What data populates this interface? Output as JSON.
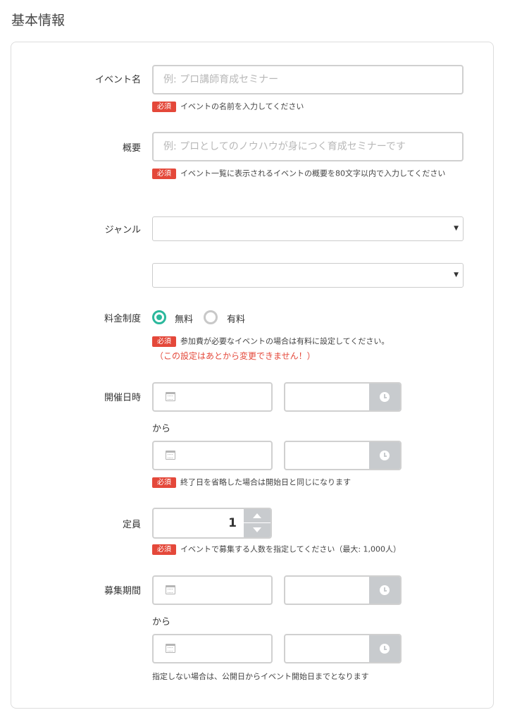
{
  "section_title": "基本情報",
  "event_name": {
    "label": "イベント名",
    "placeholder": "例: プロ講師育成セミナー",
    "required_badge": "必須",
    "help": "イベントの名前を入力してください"
  },
  "summary": {
    "label": "概要",
    "placeholder": "例: プロとしてのノウハウが身につく育成セミナーです",
    "required_badge": "必須",
    "help": "イベント一覧に表示されるイベントの概要を80文字以内で入力してください"
  },
  "genre": {
    "label": "ジャンル",
    "select1_value": "",
    "select2_value": "",
    "caret": "▼"
  },
  "fee": {
    "label": "料金制度",
    "options": [
      "無料",
      "有料"
    ],
    "selected": "無料",
    "required_badge": "必須",
    "help": "参加費が必要なイベントの場合は有料に設定してください。",
    "warning": "（この設定はあとから変更できません！）"
  },
  "event_datetime": {
    "label": "開催日時",
    "from_text": "から",
    "required_badge": "必須",
    "help": "終了日を省略した場合は開始日と同じになります"
  },
  "capacity": {
    "label": "定員",
    "value": "1",
    "required_badge": "必須",
    "help": "イベントで募集する人数を指定してください（最大: 1,000人）"
  },
  "recruit_period": {
    "label": "募集期間",
    "from_text": "から",
    "help": "指定しない場合は、公開日からイベント開始日までとなります"
  },
  "colors": {
    "accent": "#2bb89c",
    "required": "#e4483a",
    "addon": "#c8cbce"
  },
  "icons": [
    "calendar-icon",
    "clock-icon",
    "chevron-down-icon",
    "arrow-up-icon",
    "arrow-down-icon"
  ]
}
